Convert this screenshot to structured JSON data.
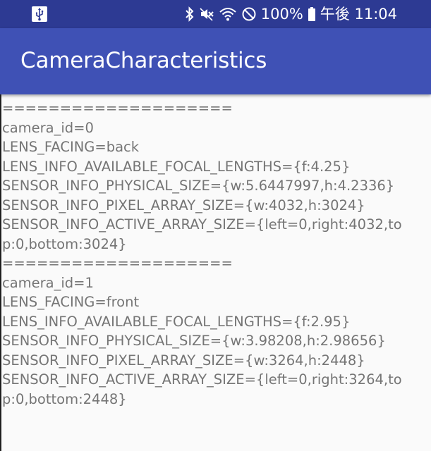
{
  "status_bar": {
    "battery_percent": "100%",
    "time": "午後 11:04",
    "icons": [
      "usb-icon",
      "bluetooth-icon",
      "vibrate-mute-icon",
      "wifi-icon",
      "do-not-disturb-icon",
      "battery-icon"
    ],
    "background": "#2d3a93"
  },
  "app_bar": {
    "title": "CameraCharacteristics",
    "background": "#3f51b5"
  },
  "content": {
    "text_color": "#757575",
    "camera0": {
      "separator": "====================",
      "camera_id": "camera_id=0",
      "lens_facing": "LENS_FACING=back",
      "focal_lengths": "LENS_INFO_AVAILABLE_FOCAL_LENGTHS={f:4.25}",
      "physical_size": "SENSOR_INFO_PHYSICAL_SIZE={w:5.6447997,h:4.2336}",
      "pixel_array_size": "SENSOR_INFO_PIXEL_ARRAY_SIZE={w:4032,h:3024}",
      "active_array_size_line1": "SENSOR_INFO_ACTIVE_ARRAY_SIZE={left=0,right:4032,to",
      "active_array_size_line2": "p:0,bottom:3024}"
    },
    "camera1": {
      "separator": "====================",
      "camera_id": "camera_id=1",
      "lens_facing": "LENS_FACING=front",
      "focal_lengths": "LENS_INFO_AVAILABLE_FOCAL_LENGTHS={f:2.95}",
      "physical_size": "SENSOR_INFO_PHYSICAL_SIZE={w:3.98208,h:2.98656}",
      "pixel_array_size": "SENSOR_INFO_PIXEL_ARRAY_SIZE={w:3264,h:2448}",
      "active_array_size_line1": "SENSOR_INFO_ACTIVE_ARRAY_SIZE={left=0,right:3264,to",
      "active_array_size_line2": "p:0,bottom:2448}"
    }
  }
}
